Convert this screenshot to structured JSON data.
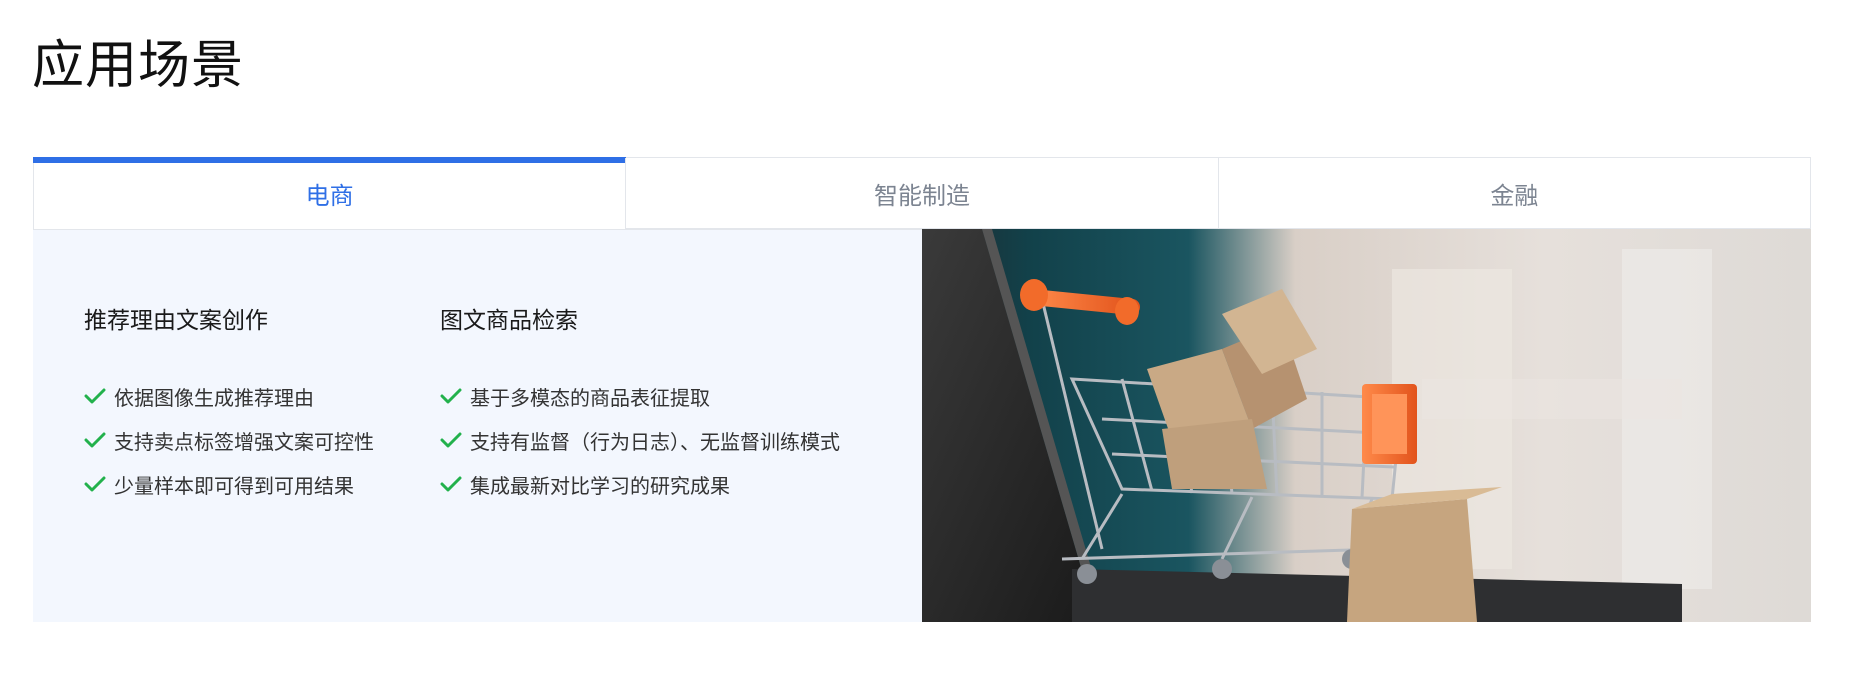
{
  "page": {
    "title": "应用场景"
  },
  "tabs": [
    {
      "label": "电商",
      "active": true
    },
    {
      "label": "智能制造",
      "active": false
    },
    {
      "label": "金融",
      "active": false
    }
  ],
  "content": {
    "columns": [
      {
        "heading": "推荐理由文案创作",
        "items": [
          "依据图像生成推荐理由",
          "支持卖点标签增强文案可控性",
          "少量样本即可得到可用结果"
        ]
      },
      {
        "heading": "图文商品检索",
        "items": [
          "基于多模态的商品表征提取",
          "支持有监督（行为日志）、无监督训练模式",
          "集成最新对比学习的研究成果"
        ]
      }
    ],
    "image": {
      "subject": "shopping-cart-with-parcels-photo"
    }
  },
  "colors": {
    "accent": "#2f6fe6",
    "check": "#22b14c",
    "panel_bg": "#f3f7fe",
    "cart_orange": "#f26b2a"
  }
}
